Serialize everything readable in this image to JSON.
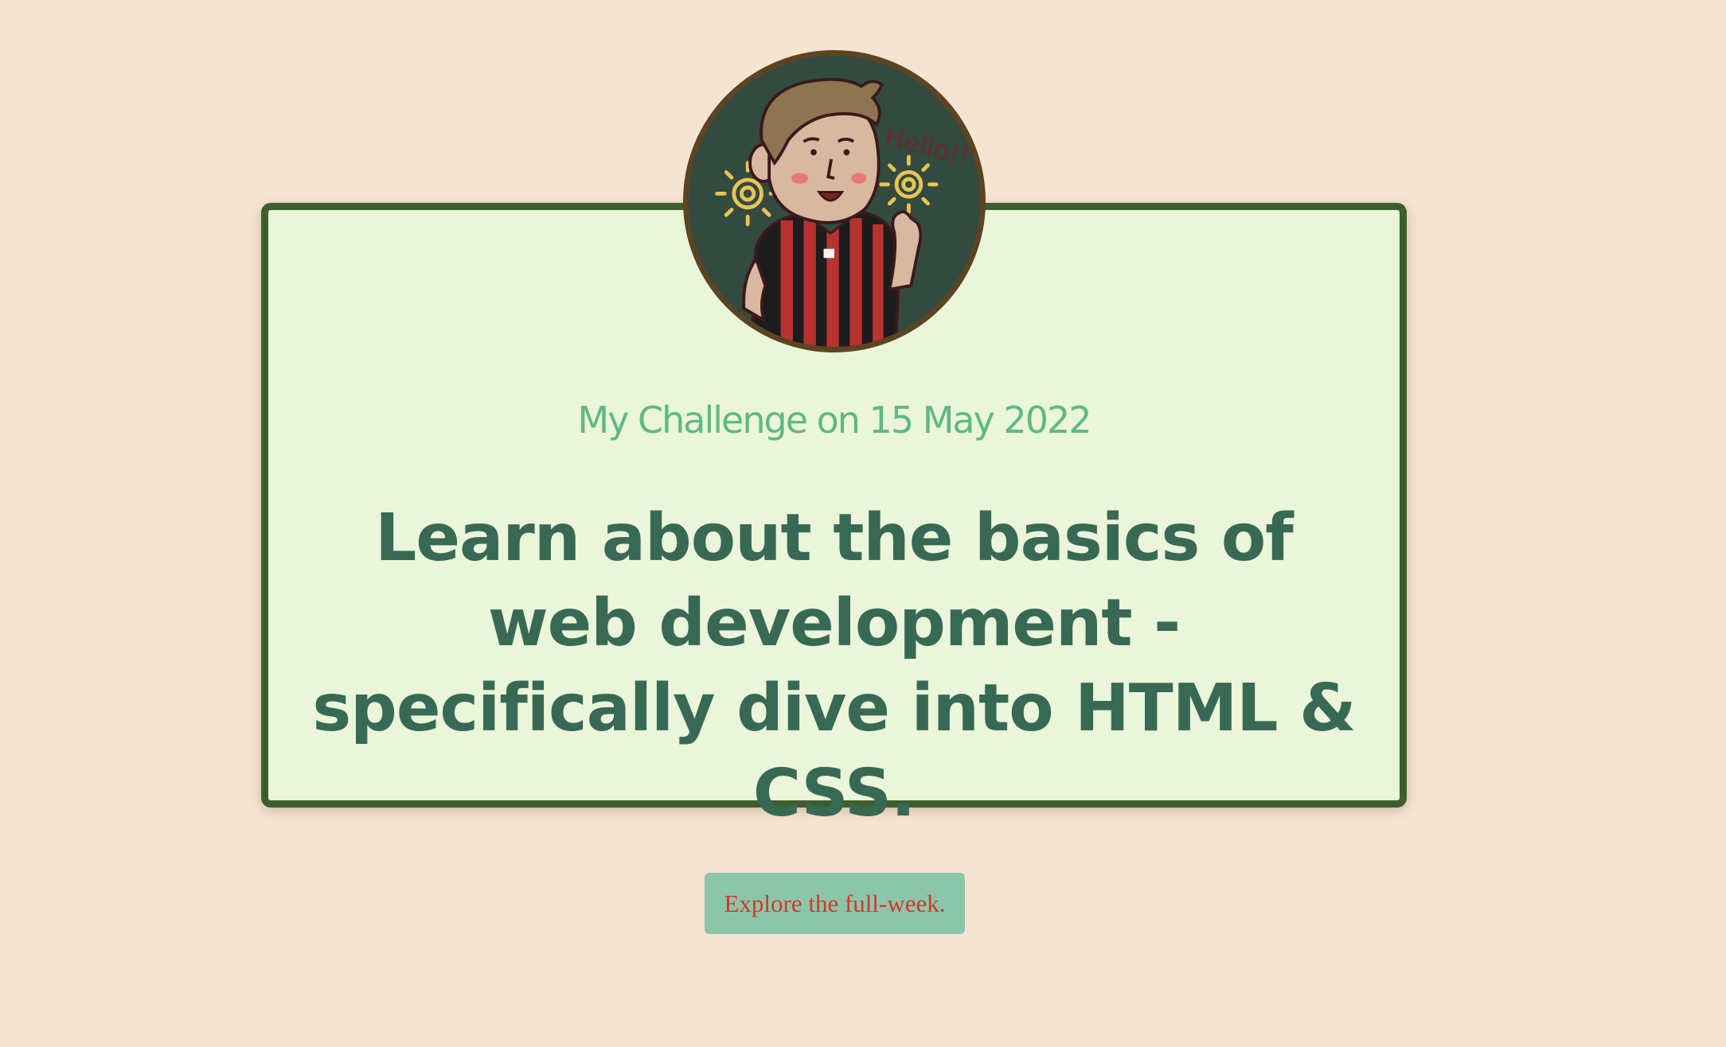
{
  "card": {
    "subtitle": "My Challenge on 15 May 2022",
    "headline": "Learn about the basics of web development - specifically dive into HTML & CSS."
  },
  "avatar": {
    "icon": "cartoon-avatar-waving",
    "speech_text": "Hello!!"
  },
  "explore_button": {
    "label": "Explore the full-week."
  },
  "colors": {
    "page_background": "#f5e4d1",
    "card_background": "#eaf5da",
    "card_border": "#3d5f2d",
    "subtitle": "#5fb885",
    "headline": "#386955",
    "button_background": "#8bc6ab",
    "button_text": "#d6352a"
  }
}
